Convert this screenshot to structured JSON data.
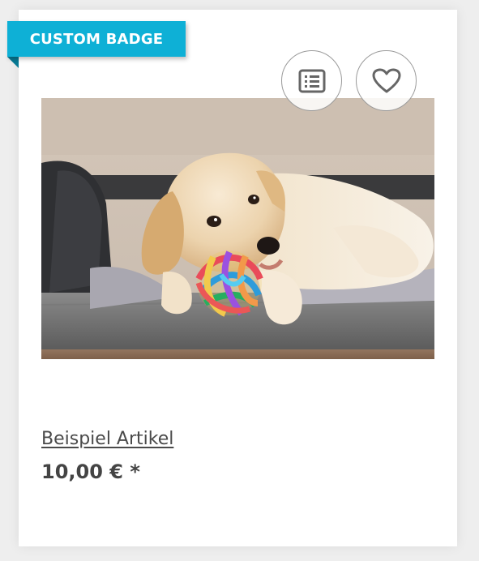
{
  "badge": {
    "label": "CUSTOM BADGE",
    "color": "#0eb0d6"
  },
  "actions": {
    "compare_icon": "list-icon",
    "wishlist_icon": "heart-icon"
  },
  "product": {
    "image_alt": "Puppy chewing a colorful toy ball",
    "name": "Beispiel Artikel",
    "price": "10,00 € *"
  }
}
